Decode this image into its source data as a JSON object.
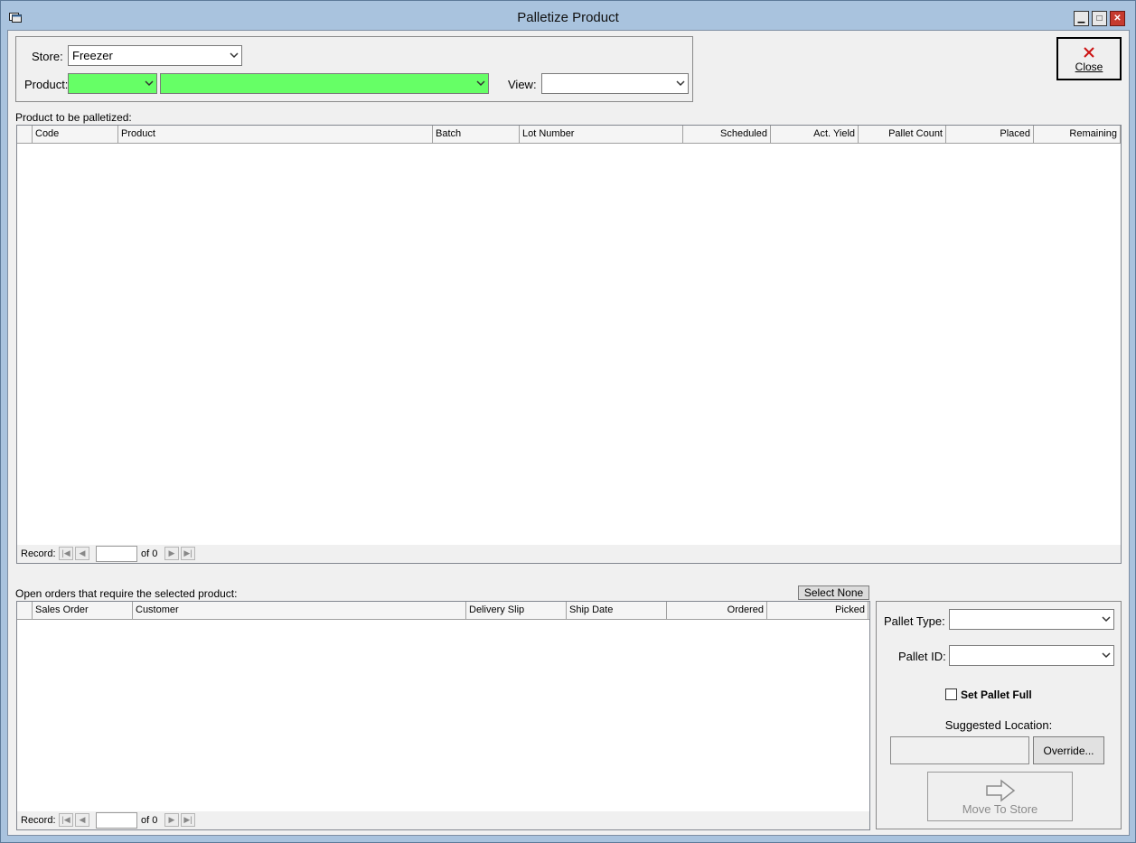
{
  "window": {
    "title": "Palletize Product",
    "min_symbol": "▁",
    "max_symbol": "□",
    "close_symbol": "✕"
  },
  "filters": {
    "store_label": "Store:",
    "store_value": "Freezer",
    "product_label": "Product:",
    "product_code_value": "",
    "product_name_value": "",
    "view_label": "View:",
    "view_value": ""
  },
  "close_button": {
    "label": "Close",
    "icon": "red-x-icon"
  },
  "products_grid": {
    "caption": "Product to be palletized:",
    "columns": [
      "Code",
      "Product",
      "Batch",
      "Lot Number",
      "Scheduled",
      "Act. Yield",
      "Pallet Count",
      "Placed",
      "Remaining"
    ],
    "rows": []
  },
  "products_nav": {
    "record_label": "Record:",
    "current": "",
    "of_label": "of 0"
  },
  "orders_grid": {
    "caption": "Open orders that require the selected product:",
    "select_none_label": "Select None",
    "columns": [
      "Sales Order",
      "Customer",
      "Delivery Slip",
      "Ship Date",
      "Ordered",
      "Picked"
    ],
    "rows": []
  },
  "orders_nav": {
    "record_label": "Record:",
    "current": "",
    "of_label": "of 0"
  },
  "pallet_panel": {
    "pallet_type_label": "Pallet Type:",
    "pallet_type_value": "",
    "pallet_id_label": "Pallet ID:",
    "pallet_id_value": "",
    "set_pallet_full_label": "Set Pallet Full",
    "set_pallet_full_checked": false,
    "suggested_location_label": "Suggested Location:",
    "suggested_location_value": "",
    "override_label": "Override...",
    "move_to_store_label": "Move To Store",
    "move_icon": "right-arrow-icon"
  },
  "colors": {
    "title_bar": "#a9c3de",
    "product_combo_green": "#66ff66",
    "close_icon_red": "#cc1111",
    "disabled_text": "#8c8c8c"
  }
}
